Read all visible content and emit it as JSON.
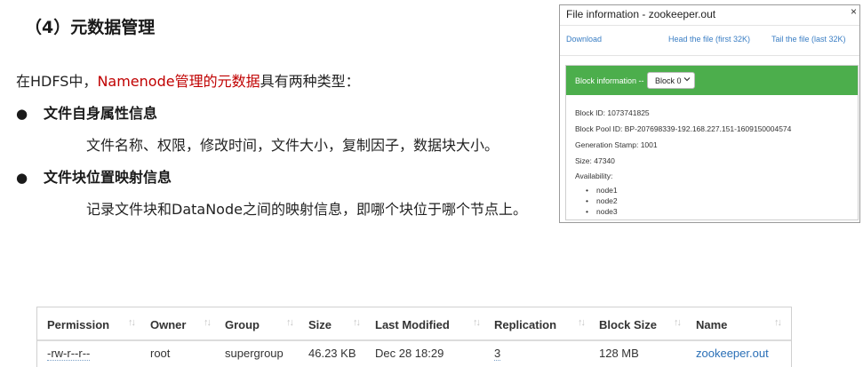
{
  "slide": {
    "heading": "（4）元数据管理",
    "intro_before": "在HDFS中，",
    "intro_highlight": "Namenode管理的元数据",
    "intro_after": "具有两种类型：",
    "bullets": [
      {
        "title": "文件自身属性信息",
        "detail": "文件名称、权限，修改时间，文件大小，复制因子，数据块大小。"
      },
      {
        "title": "文件块位置映射信息",
        "detail": "记录文件块和DataNode之间的映射信息，即哪个块位于哪个节点上。"
      }
    ],
    "bullet_symbol": "●"
  },
  "file_info": {
    "title": "File information - zookeeper.out",
    "close": "×",
    "links": [
      "Download",
      "Head the file (first 32K)",
      "Tail the file (last 32K)"
    ],
    "block_header_label": "Block information --",
    "block_select_value": "Block 0",
    "block_id": "Block ID: 1073741825",
    "block_pool_id": "Block Pool ID: BP-207698339-192.168.227.151-1609150004574",
    "generation_stamp": "Generation Stamp: 1001",
    "size": "Size: 47340",
    "availability_label": "Availability:",
    "nodes": [
      "node1",
      "node2",
      "node3"
    ],
    "header_color": "#4cae4c"
  },
  "file_table": {
    "sort_icon": "sort-arrows-icon",
    "columns": [
      "Permission",
      "Owner",
      "Group",
      "Size",
      "Last Modified",
      "Replication",
      "Block Size",
      "Name"
    ],
    "rows": [
      [
        "-rw-r--r--",
        "root",
        "supergroup",
        "46.23 KB",
        "Dec 28 18:29",
        "3",
        "128 MB",
        "zookeeper.out"
      ]
    ],
    "link_color": "#2a6fb6"
  }
}
